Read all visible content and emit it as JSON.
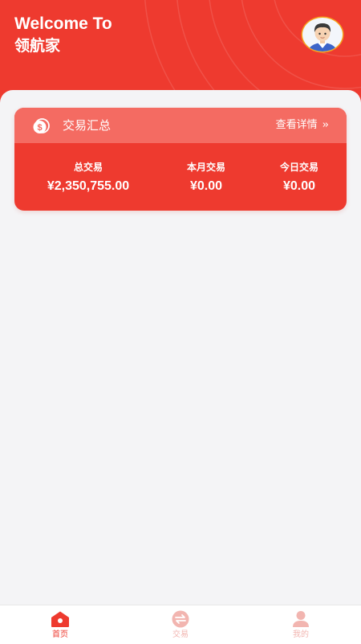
{
  "header": {
    "welcome": "Welcome To",
    "brand": "领航家"
  },
  "summary": {
    "title": "交易汇总",
    "detail_link": "查看详情",
    "stats": [
      {
        "label": "总交易",
        "value": "¥2,350,755.00"
      },
      {
        "label": "本月交易",
        "value": "¥0.00"
      },
      {
        "label": "今日交易",
        "value": "¥0.00"
      }
    ]
  },
  "tabbar": {
    "items": [
      {
        "label": "首页",
        "icon": "home-icon",
        "active": true
      },
      {
        "label": "交易",
        "icon": "exchange-icon",
        "active": false
      },
      {
        "label": "我的",
        "icon": "user-icon",
        "active": false
      }
    ]
  },
  "colors": {
    "primary": "#ee3a2f",
    "card_header": "#f46b62",
    "background": "#f4f4f6",
    "tab_inactive": "#f2b5b0"
  }
}
